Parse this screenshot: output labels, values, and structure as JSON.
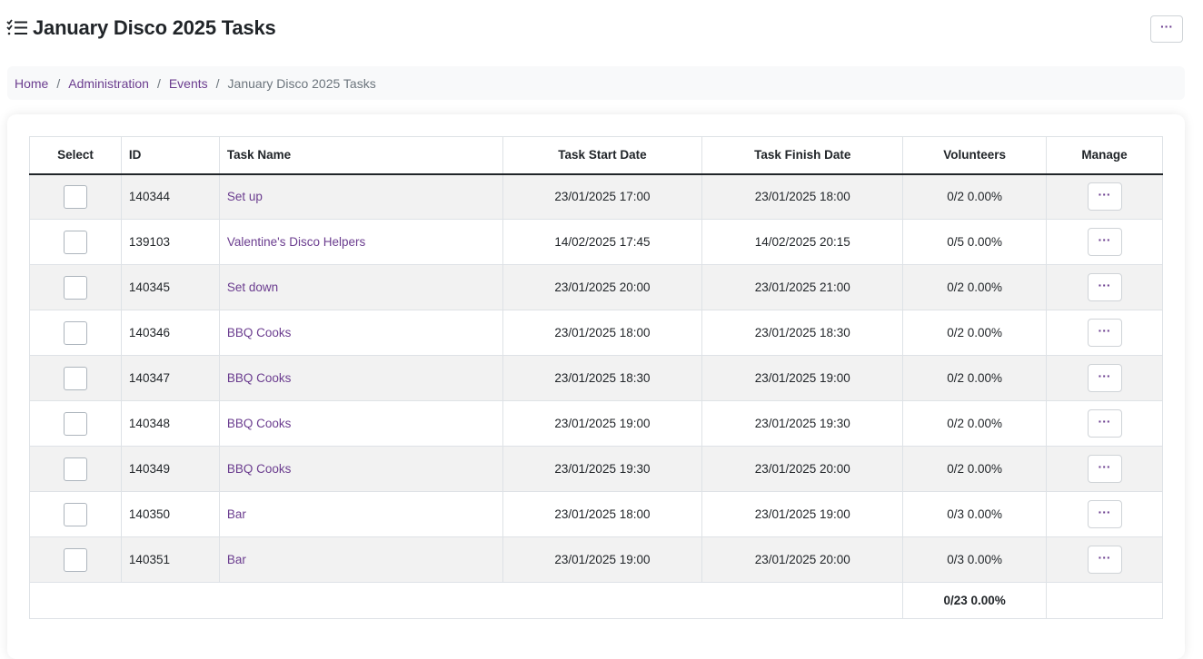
{
  "header": {
    "title": "January Disco 2025 Tasks",
    "title_icon": "task-list-icon",
    "menu_icon": "ellipsis-icon",
    "menu_label": "···"
  },
  "breadcrumb": {
    "items": [
      "Home",
      "Administration",
      "Events"
    ],
    "separator": "/",
    "current": "January Disco 2025 Tasks"
  },
  "table": {
    "columns": {
      "select": "Select",
      "id": "ID",
      "name": "Task Name",
      "start": "Task Start Date",
      "finish": "Task Finish Date",
      "volunteers": "Volunteers",
      "manage": "Manage"
    },
    "manage_label": "···",
    "rows": [
      {
        "id": "140344",
        "name": "Set up",
        "start": "23/01/2025 17:00",
        "finish": "23/01/2025 18:00",
        "volunteers": "0/2 0.00%"
      },
      {
        "id": "139103",
        "name": "Valentine's Disco Helpers",
        "start": "14/02/2025 17:45",
        "finish": "14/02/2025 20:15",
        "volunteers": "0/5 0.00%"
      },
      {
        "id": "140345",
        "name": "Set down",
        "start": "23/01/2025 20:00",
        "finish": "23/01/2025 21:00",
        "volunteers": "0/2 0.00%"
      },
      {
        "id": "140346",
        "name": "BBQ Cooks",
        "start": "23/01/2025 18:00",
        "finish": "23/01/2025 18:30",
        "volunteers": "0/2 0.00%"
      },
      {
        "id": "140347",
        "name": "BBQ Cooks",
        "start": "23/01/2025 18:30",
        "finish": "23/01/2025 19:00",
        "volunteers": "0/2 0.00%"
      },
      {
        "id": "140348",
        "name": "BBQ Cooks",
        "start": "23/01/2025 19:00",
        "finish": "23/01/2025 19:30",
        "volunteers": "0/2 0.00%"
      },
      {
        "id": "140349",
        "name": "BBQ Cooks",
        "start": "23/01/2025 19:30",
        "finish": "23/01/2025 20:00",
        "volunteers": "0/2 0.00%"
      },
      {
        "id": "140350",
        "name": "Bar",
        "start": "23/01/2025 18:00",
        "finish": "23/01/2025 19:00",
        "volunteers": "0/3 0.00%"
      },
      {
        "id": "140351",
        "name": "Bar",
        "start": "23/01/2025 19:00",
        "finish": "23/01/2025 20:00",
        "volunteers": "0/3 0.00%"
      }
    ],
    "total_volunteers": "0/23 0.00%"
  },
  "colors": {
    "link": "#6b3d8f",
    "stripe": "#f2f2f2",
    "border": "#dee2e6"
  }
}
